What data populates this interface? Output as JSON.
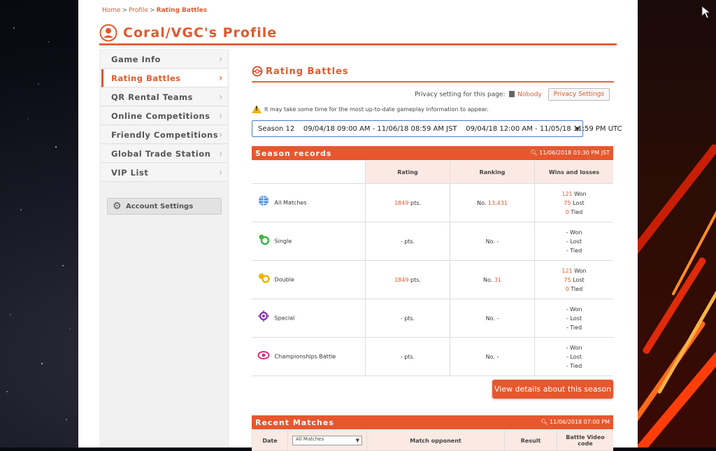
{
  "breadcrumb": {
    "home": "Home",
    "profile": "Profile",
    "current": "Rating Battles"
  },
  "page_title": "Coral/VGC's Profile",
  "sidebar": {
    "items": [
      {
        "label": "Game Info"
      },
      {
        "label": "Rating Battles",
        "active": true
      },
      {
        "label": "QR Rental Teams"
      },
      {
        "label": "Online Competitions"
      },
      {
        "label": "Friendly Competitions"
      },
      {
        "label": "Global Trade Station"
      },
      {
        "label": "VIP List"
      }
    ],
    "account_settings": "Account Settings"
  },
  "main": {
    "section_title": "Rating Battles",
    "privacy_label": "Privacy setting for this page:",
    "privacy_value": "Nobody",
    "privacy_button": "Privacy Settings",
    "notice": "It may take some time for the most up-to-date gameplay information to appear.",
    "season_select": "Season 12    09/04/18 09:00 AM - 11/06/18 08:59 AM JST    09/04/18 12:00 AM - 11/05/18 11:59 PM UTC"
  },
  "season_records": {
    "title": "Season records",
    "timestamp": "11/06/2018 03:30 PM  JST",
    "columns": [
      "Rating",
      "Ranking",
      "Wins and losses"
    ],
    "rows": [
      {
        "category": "All Matches",
        "icon": "globe-icon",
        "rating": "1849",
        "rating_unit": "pts.",
        "rank_prefix": "No.",
        "rank": "13,431",
        "won": "121",
        "lost": "75",
        "tied": "0"
      },
      {
        "category": "Single",
        "icon": "single-battle-icon",
        "rating": "-",
        "rating_unit": "pts.",
        "rank_prefix": "No.",
        "rank": "-",
        "won": "-",
        "lost": "-",
        "tied": "-"
      },
      {
        "category": "Double",
        "icon": "double-battle-icon",
        "rating": "1849",
        "rating_unit": "pts.",
        "rank_prefix": "No.",
        "rank": "31",
        "won": "121",
        "lost": "75",
        "tied": "0"
      },
      {
        "category": "Special",
        "icon": "special-battle-icon",
        "rating": "-",
        "rating_unit": "pts.",
        "rank_prefix": "No.",
        "rank": "-",
        "won": "-",
        "lost": "-",
        "tied": "-"
      },
      {
        "category": "Championships Battle",
        "icon": "championships-icon",
        "rating": "-",
        "rating_unit": "pts.",
        "rank_prefix": "No.",
        "rank": "-",
        "won": "-",
        "lost": "-",
        "tied": "-"
      }
    ],
    "won_label": "Won",
    "lost_label": "Lost",
    "tied_label": "Tied",
    "view_button": "View details about this season"
  },
  "recent_matches": {
    "title": "Recent Matches",
    "timestamp": "11/06/2018 07:00 PM",
    "columns": [
      "Date",
      "Match opponent",
      "Result",
      "Battle Video code"
    ],
    "filter": "All Matches"
  },
  "colors": {
    "accent": "#e8572e",
    "highlight": "#e05a2e",
    "header_bg": "#fbeae3"
  }
}
